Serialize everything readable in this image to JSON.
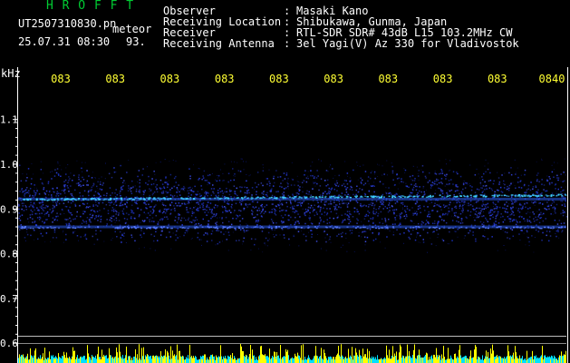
{
  "header": {
    "logo": "H R O F F T",
    "filename": "UT2507310830.pn",
    "event_label": "meteor",
    "timestamp": "25.07.31 08:30",
    "count": "93.",
    "fields": [
      {
        "label": "Observer",
        "value": "Masaki Kano"
      },
      {
        "label": "Receiving Location",
        "value": "Shibukawa, Gunma, Japan"
      },
      {
        "label": "Receiver",
        "value": "RTL-SDR SDR# 43dB L15 103.2MHz CW"
      },
      {
        "label": "Receiving Antenna",
        "value": "3el Yagi(V) Az 330 for Vladivostok"
      }
    ]
  },
  "chart_data": {
    "type": "heatmap",
    "ylabel": "kHz",
    "yticks": [
      "1.1",
      "1.0",
      "0.9",
      "0.8",
      "0.7",
      "0.6"
    ],
    "ylim": [
      0.58,
      1.2
    ],
    "xticks": [
      "083",
      "083",
      "083",
      "083",
      "083",
      "083",
      "083",
      "083",
      "083",
      "0840"
    ],
    "signal_band": [
      0.82,
      1.0
    ],
    "carrier_lines_khz": [
      0.92,
      0.86
    ],
    "grid": false
  },
  "colors": {
    "background": "#000000",
    "logo": "#00cc33",
    "header_text": "#ffffff",
    "tick_labels": "#ffff33",
    "axis_lines": "#ffffff",
    "signal_blue": "#2030c0",
    "carrier": "#40d0ff",
    "amplitude_yellow": "#ffff00",
    "amplitude_cyan": "#00e0ff"
  }
}
